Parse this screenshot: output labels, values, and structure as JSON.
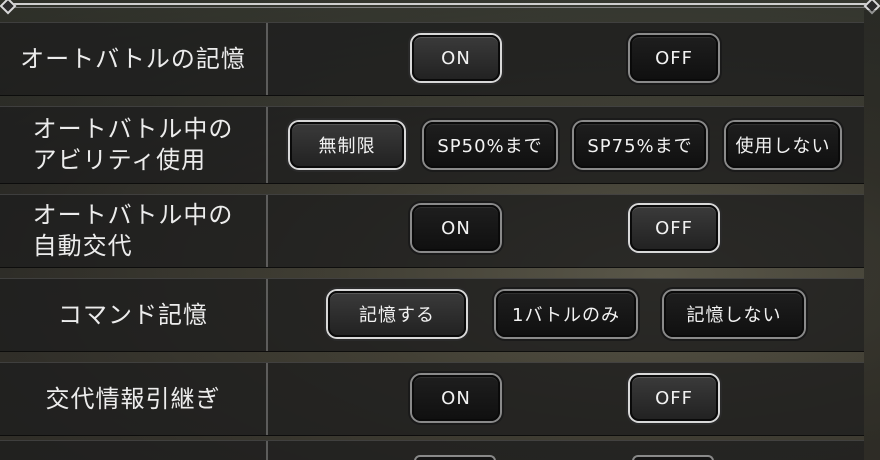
{
  "settings": [
    {
      "label": "オートバトルの記憶",
      "options": [
        "ON",
        "OFF"
      ],
      "selected": 0
    },
    {
      "label": "オートバトル中の\nアビリティ使用",
      "options": [
        "無制限",
        "SP50%まで",
        "SP75%まで",
        "使用しない"
      ],
      "selected": 0
    },
    {
      "label": "オートバトル中の\n自動交代",
      "options": [
        "ON",
        "OFF"
      ],
      "selected": 1
    },
    {
      "label": "コマンド記憶",
      "options": [
        "記憶する",
        "1バトルのみ",
        "記憶しない"
      ],
      "selected": 0
    },
    {
      "label": "交代情報引継ぎ",
      "options": [
        "ON",
        "OFF"
      ],
      "selected": 1
    }
  ]
}
